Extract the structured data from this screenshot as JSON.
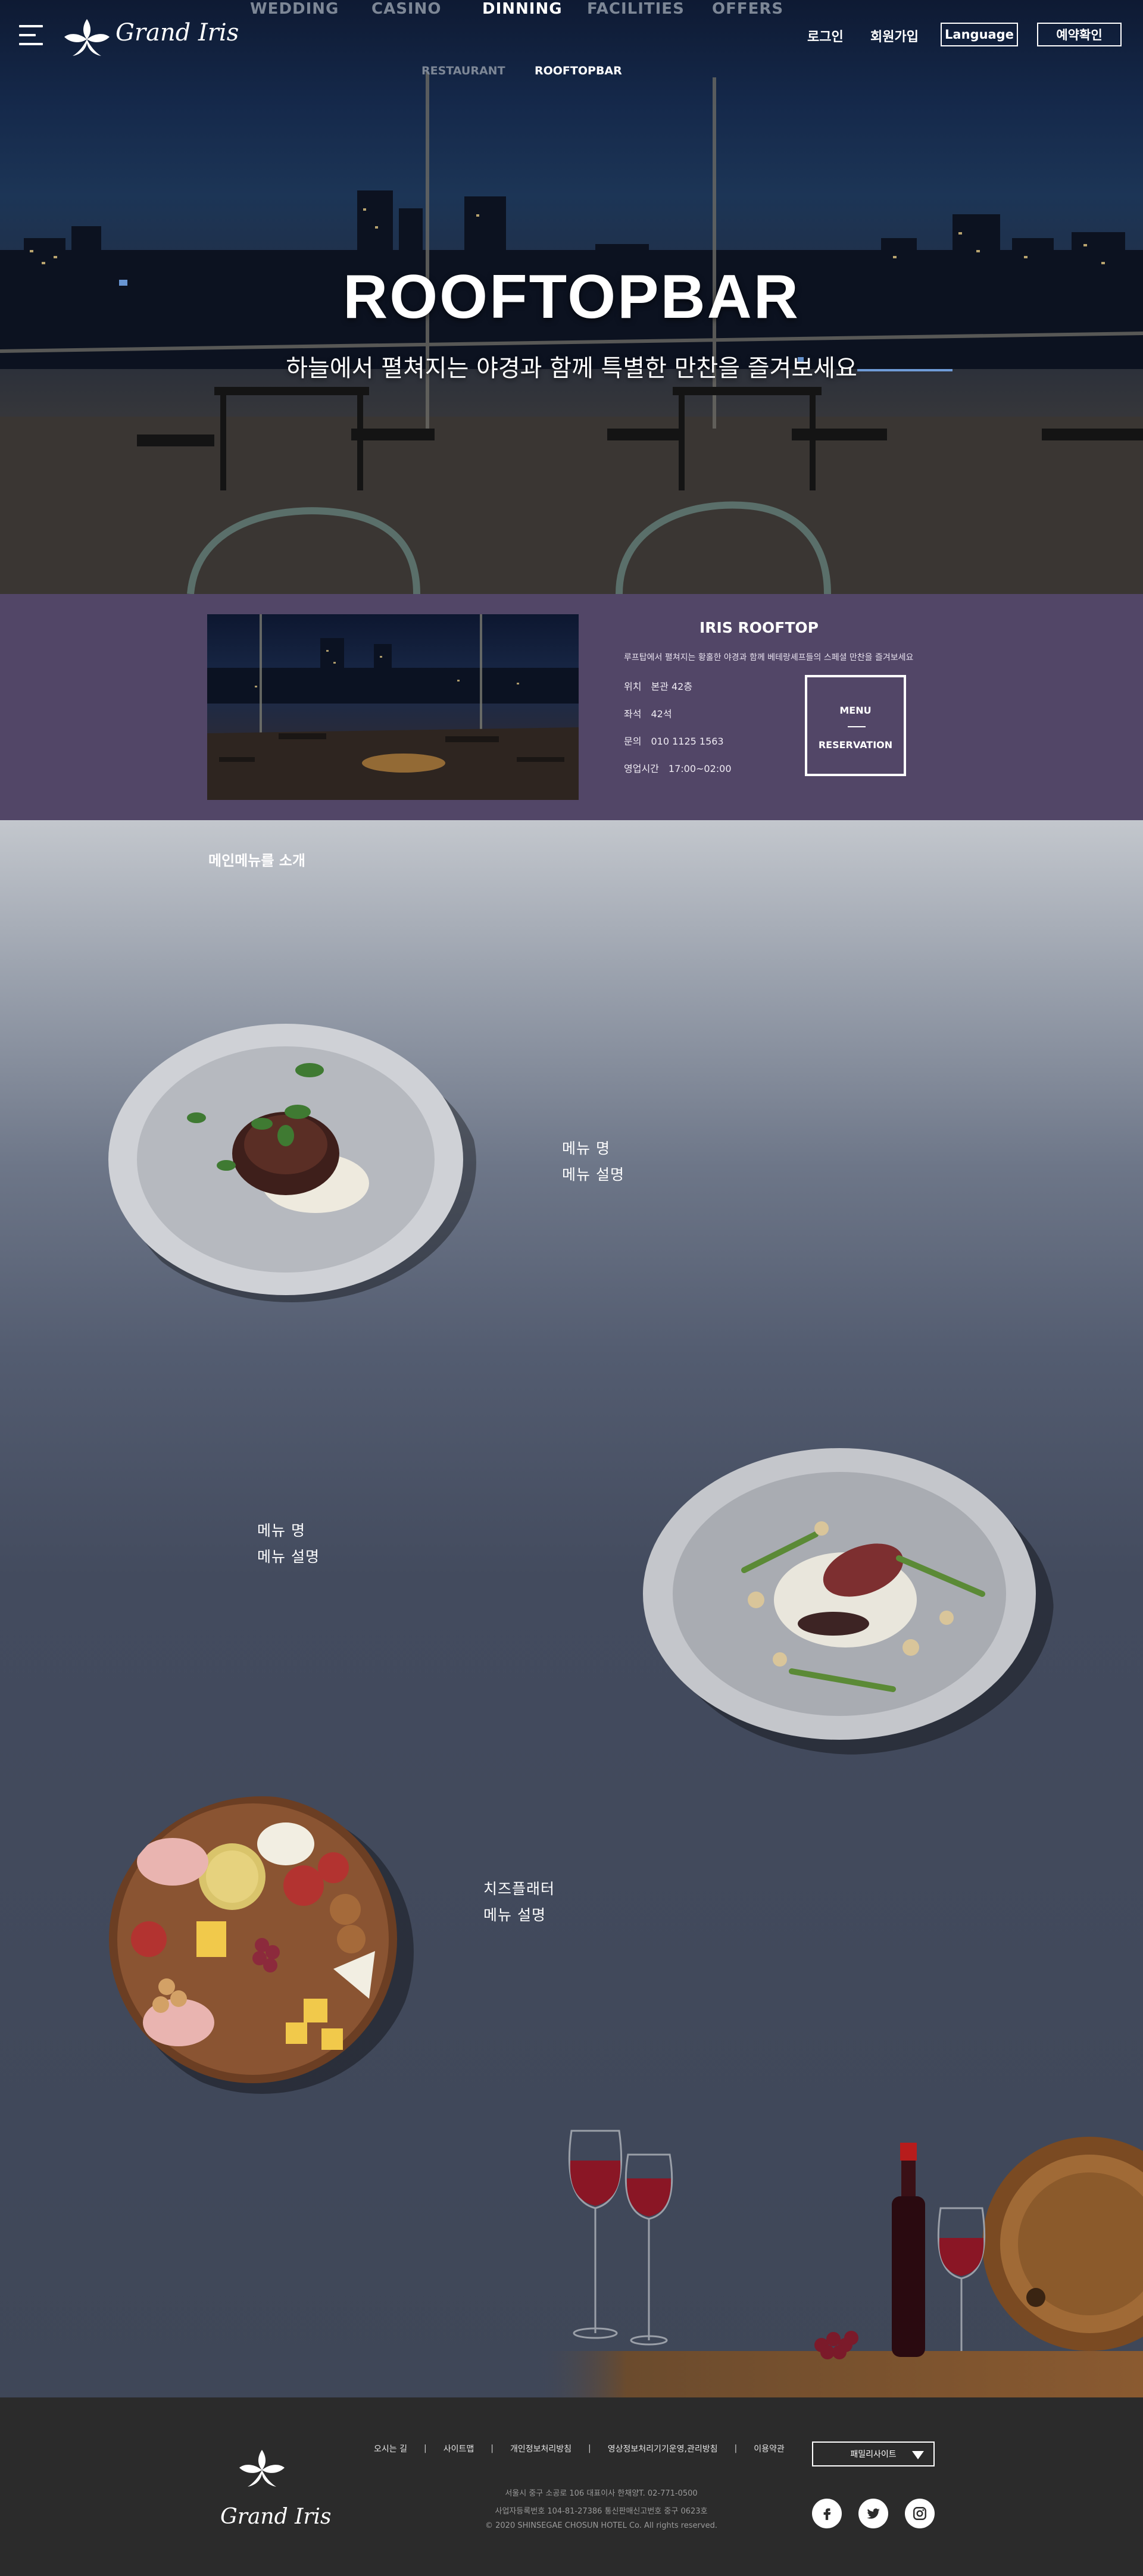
{
  "header": {
    "brand": "Grand Iris",
    "nav": [
      "WEDDING",
      "CASINO",
      "DINNING",
      "FACILITIES",
      "OFFERS"
    ],
    "active_nav": "DINNING",
    "subnav": [
      "RESTAURANT",
      "ROOFTOPBAR"
    ],
    "active_subnav": "ROOFTOPBAR",
    "login": "로그인",
    "signup": "회원가입",
    "language": "Language",
    "reservation_check": "예약확인"
  },
  "hero": {
    "title": "ROOFTOPBAR",
    "subtitle": "하늘에서 펼쳐지는 야경과 함께 특별한 만찬을 즐겨보세요"
  },
  "info": {
    "title": "IRIS ROOFTOP",
    "description": "루프탑에서 펼쳐지는 황홀한 야경과 함께 베테랑셰프들의 스페셜 만찬을 즐겨보세요",
    "rows": [
      {
        "key": "위치",
        "value": "본관 42층"
      },
      {
        "key": "좌석",
        "value": "42석"
      },
      {
        "key": "문의",
        "value": "010 1125 1563"
      },
      {
        "key": "영업시간",
        "value": "17:00~02:00"
      }
    ],
    "button_top": "MENU",
    "button_bottom": "RESERVATION"
  },
  "menu": {
    "heading": "메인메뉴를 소개",
    "items": [
      {
        "name": "메뉴 명",
        "desc": "메뉴 설명"
      },
      {
        "name": "메뉴 명",
        "desc": "메뉴 설명"
      },
      {
        "name": "치즈플래터",
        "desc": "메뉴 설명"
      }
    ]
  },
  "footer": {
    "brand": "Grand Iris",
    "links": [
      "오시는 길",
      "사이트맵",
      "개인정보처리방침",
      "영상정보처리기기운영,관리방침",
      "이용약관"
    ],
    "address": "서울시 중구 소공로 106 대표이사 한채양T. 02-771-0500",
    "business": "사업자등록번호 104-81-27386 통신판매신고번호 중구 0623호",
    "copyright": "© 2020 SHINSEGAE CHOSUN HOTEL Co. All rights reserved.",
    "family_site": "패밀리사이트",
    "social": [
      "facebook-icon",
      "twitter-icon",
      "instagram-icon"
    ]
  },
  "colors": {
    "info_bg": "#524667",
    "footer_bg": "#2b2b2b",
    "nav_dim": "#7d8796"
  }
}
